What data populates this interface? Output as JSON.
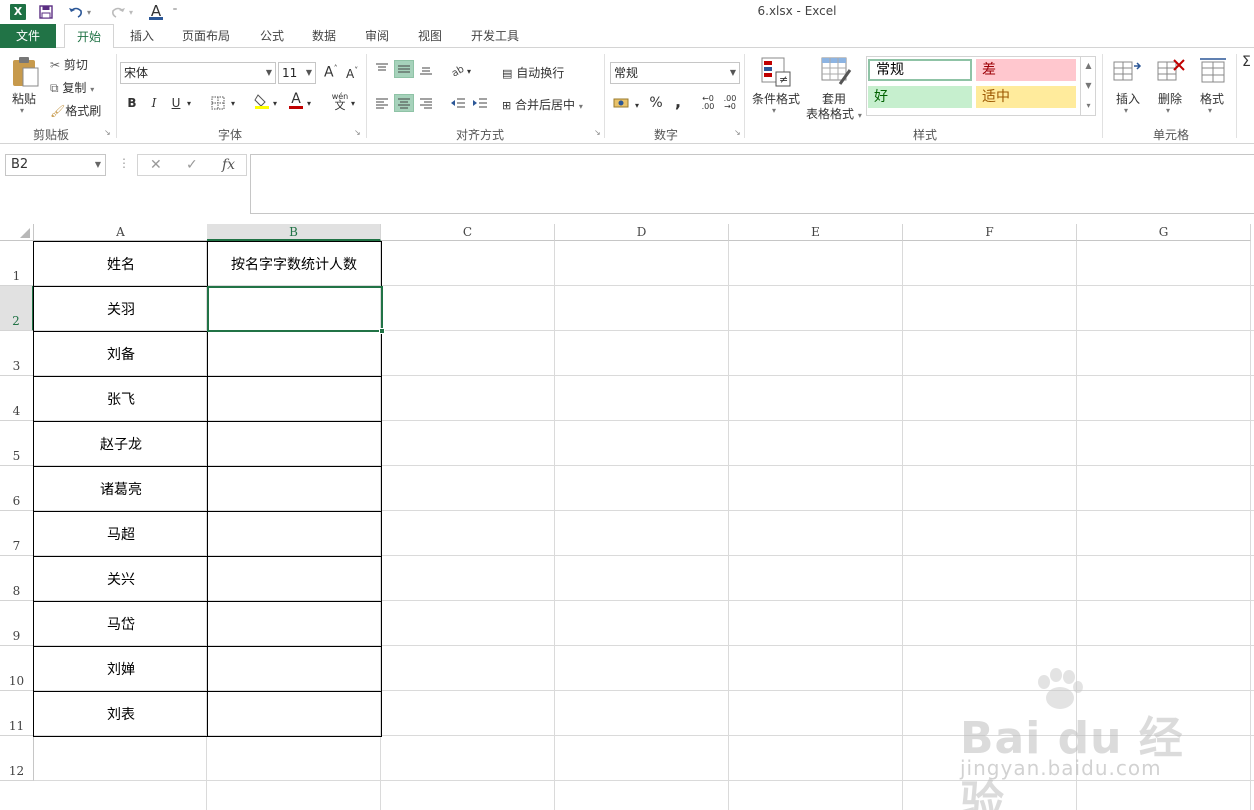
{
  "window": {
    "title": "6.xlsx - Excel"
  },
  "quick_access": {
    "logo": "X",
    "font_color_letter": "A"
  },
  "tabs": [
    "文件",
    "开始",
    "插入",
    "页面布局",
    "公式",
    "数据",
    "审阅",
    "视图",
    "开发工具"
  ],
  "ribbon": {
    "clipboard": {
      "paste": "粘贴",
      "cut": "剪切",
      "copy": "复制",
      "format_painter": "格式刷",
      "label": "剪贴板"
    },
    "font": {
      "name": "宋体",
      "size": "11",
      "grow": "A",
      "shrink": "A",
      "bold": "B",
      "italic": "I",
      "underline": "U",
      "wen": "wén",
      "label": "字体"
    },
    "alignment": {
      "wrap": "自动换行",
      "merge": "合并后居中",
      "label": "对齐方式"
    },
    "number": {
      "format": "常规",
      "percent": "%",
      "comma": ",",
      "label": "数字"
    },
    "styles": {
      "conditional": "条件格式",
      "table1": "套用",
      "table2": "表格格式",
      "normal": "常规",
      "bad": "差",
      "good": "好",
      "neutral": "适中",
      "label": "样式"
    },
    "cells": {
      "insert": "插入",
      "delete": "删除",
      "format": "格式",
      "label": "单元格"
    }
  },
  "formula_bar": {
    "name_box": "B2",
    "fx": "fx",
    "cancel": "✕",
    "confirm": "✓"
  },
  "columns": [
    "A",
    "B",
    "C",
    "D",
    "E",
    "F",
    "G"
  ],
  "rows": [
    "1",
    "2",
    "3",
    "4",
    "5",
    "6",
    "7",
    "8",
    "9",
    "10",
    "11",
    "12"
  ],
  "sheet": {
    "header_a": "姓名",
    "header_b": "按名字字数统计人数",
    "names": [
      "关羽",
      "刘备",
      "张飞",
      "赵子龙",
      "诸葛亮",
      "马超",
      "关兴",
      "马岱",
      "刘婵",
      "刘表"
    ]
  },
  "watermark": {
    "logo": "Bai du 经验",
    "url": "jingyan.baidu.com"
  },
  "colors": {
    "accent": "#217346",
    "bad_bg": "#ffc7ce",
    "bad_fg": "#9c0006",
    "good_bg": "#c6efce",
    "good_fg": "#006100",
    "neutral_bg": "#ffeb9c",
    "neutral_fg": "#9c5700"
  }
}
